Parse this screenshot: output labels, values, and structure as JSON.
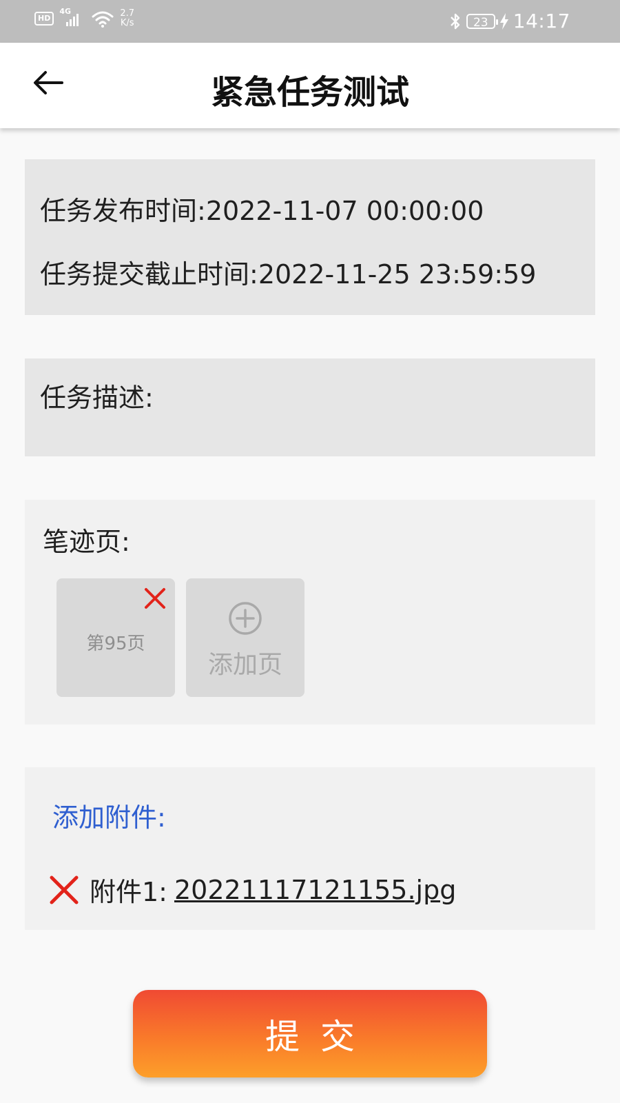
{
  "status_bar": {
    "hd_badge": "HD",
    "signal_tag": "4G",
    "net_speed_value": "2.7",
    "net_speed_unit": "K/s",
    "battery_level": "23",
    "time": "14:17",
    "icons": [
      "hd-icon",
      "signal-icon",
      "wifi-icon",
      "bluetooth-icon",
      "battery-icon",
      "charging-icon"
    ]
  },
  "header": {
    "title": "紧急任务测试",
    "back_icon": "back-arrow-icon"
  },
  "task_times": {
    "publish_label": "任务发布时间:",
    "publish_value": "2022-11-07 00:00:00",
    "deadline_label": "任务提交截止时间:",
    "deadline_value": "2022-11-25 23:59:59"
  },
  "description": {
    "label": "任务描述:",
    "value": ""
  },
  "pages": {
    "label": "笔迹页:",
    "items": [
      {
        "label": "第95页",
        "remove_icon": "close-icon"
      }
    ],
    "add_label": "添加页",
    "add_icon": "plus-circle-icon"
  },
  "attachments": {
    "add_label": "添加附件:",
    "items": [
      {
        "prefix": "附件1:",
        "filename": "20221117121155.jpg",
        "remove_icon": "close-icon"
      }
    ]
  },
  "actions": {
    "submit_label": "提交"
  },
  "colors": {
    "status_bar_bg": "#bdbdbd",
    "link_blue": "#2f5fd0",
    "delete_red": "#e2231a",
    "submit_gradient_top": "#f04a33",
    "submit_gradient_bottom": "#fd9f2a"
  }
}
